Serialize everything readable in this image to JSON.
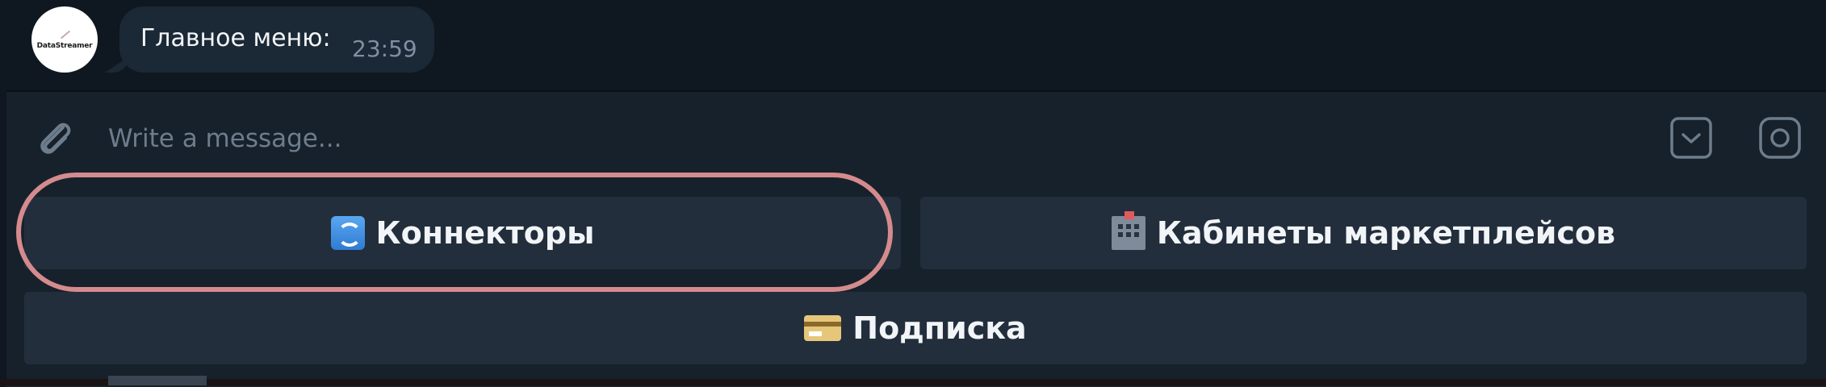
{
  "chat": {
    "avatar_text": "DataStreamer",
    "message_text": "Главное меню:",
    "message_time": "23:59"
  },
  "composer": {
    "placeholder": "Write a message..."
  },
  "keyboard": {
    "buttons": [
      {
        "label": "Коннекторы",
        "emoji": "counterclockwise-arrows-icon"
      },
      {
        "label": "Кабинеты маркетплейсов",
        "emoji": "office-building-icon"
      },
      {
        "label": "Подписка",
        "emoji": "credit-card-icon"
      }
    ]
  },
  "colors": {
    "chat_bg": "#0f1721",
    "composer_bg": "#17212b",
    "button_bg": "#232e3c",
    "bubble_bg": "#1b2836",
    "highlight": "#d58b8d"
  }
}
